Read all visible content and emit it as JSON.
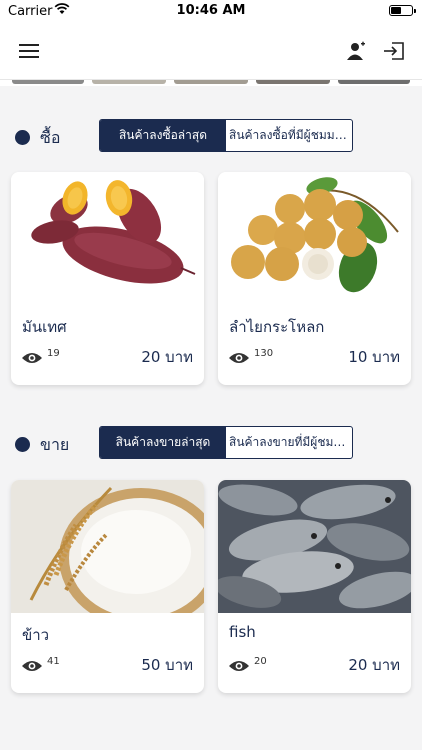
{
  "status_bar": {
    "carrier": "Carrier",
    "time": "10:46 AM"
  },
  "navbar": {
    "menu_icon": "hamburger-menu-icon",
    "user_icon": "user-add-icon",
    "logout_icon": "logout-icon"
  },
  "colors": {
    "primary": "#1b2b4f",
    "background": "#f4f4f5",
    "card": "#ffffff"
  },
  "buy_section": {
    "title": "ซื้อ",
    "tabs": [
      {
        "label": "สินค้าลงซื้อล่าสุด",
        "active": true
      },
      {
        "label": "สินค้าลงซื้อที่มีผู้ชมมากที่สุด",
        "active": false
      }
    ],
    "items": [
      {
        "name": "มันเทศ",
        "views": "19",
        "price": "20 บาท",
        "image": "sweet-potato"
      },
      {
        "name": "ลำไยกระโหลก",
        "views": "130",
        "price": "10 บาท",
        "image": "longan"
      }
    ]
  },
  "sell_section": {
    "title": "ขาย",
    "tabs": [
      {
        "label": "สินค้าลงขายล่าสุด",
        "active": true
      },
      {
        "label": "สินค้าลงขายที่มีผู้ชมมากที่สุด",
        "active": false
      }
    ],
    "items": [
      {
        "name": "ข้าว",
        "views": "41",
        "price": "50 บาท",
        "image": "rice"
      },
      {
        "name": "fish",
        "views": "20",
        "price": "20 บาท",
        "image": "fish"
      }
    ]
  }
}
